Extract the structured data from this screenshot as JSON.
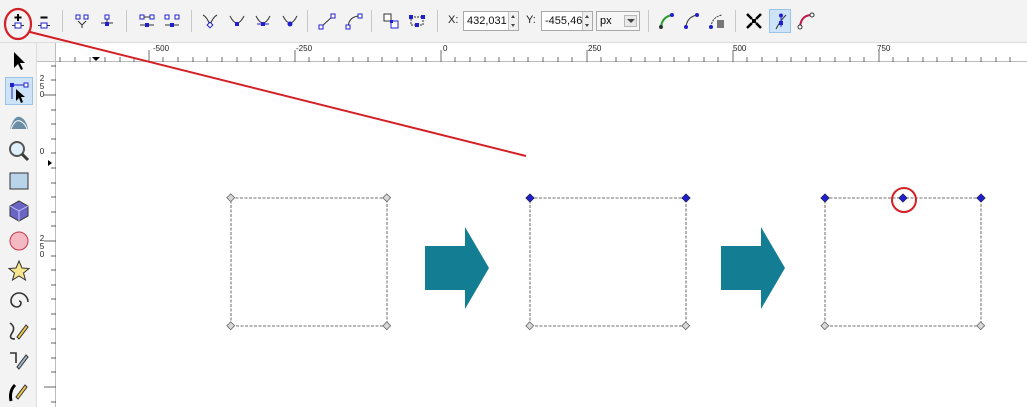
{
  "toolbar": {
    "x_label": "X:",
    "x_value": "432,031",
    "y_label": "Y:",
    "y_value": "-455,46",
    "unit": "px"
  },
  "ruler": {
    "h_labels": [
      "-500",
      "-250",
      "0",
      "250",
      "500",
      "750"
    ],
    "v_labels": [
      [
        "2",
        "5",
        "0"
      ],
      [
        "0"
      ],
      [
        "2",
        "5",
        "0"
      ]
    ]
  },
  "colors": {
    "accent_blue": "#cde3f7",
    "arrow_teal": "#137e93",
    "annotation_red": "#d31f26",
    "node_blue": "#1f1fd0"
  }
}
